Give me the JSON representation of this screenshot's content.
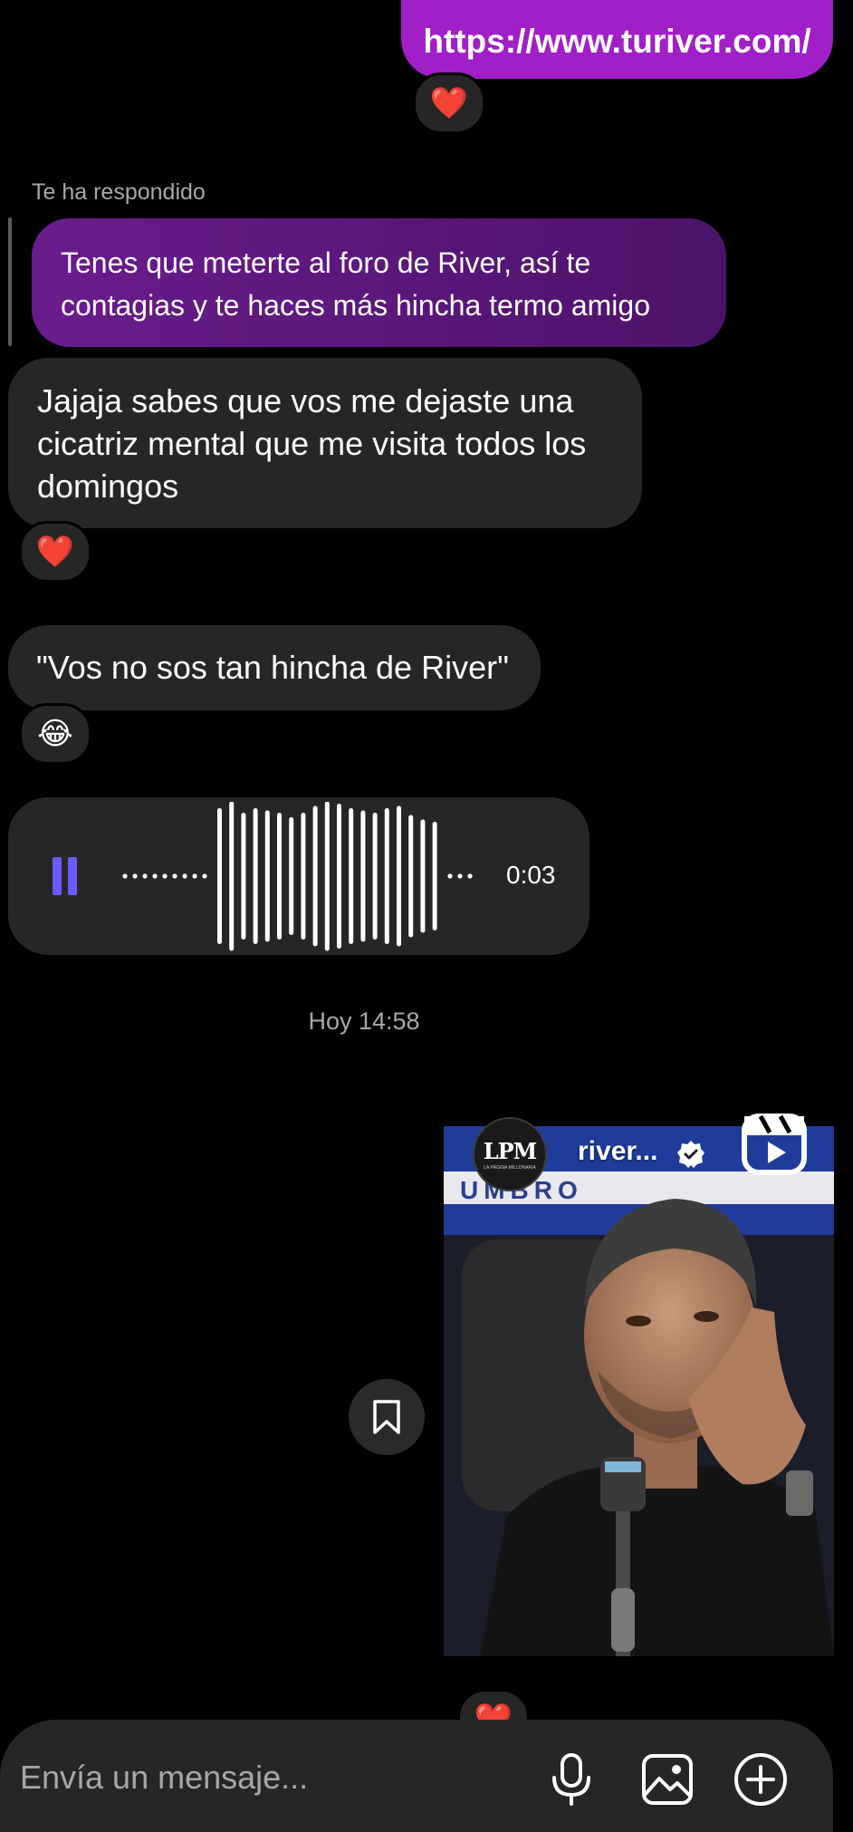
{
  "messages": {
    "sent_link": "https://www.turiver.com/",
    "reply_label": "Te ha respondido",
    "replied_text": "Tenes que meterte al foro de River, así te contagias y te haces más hincha termo amigo",
    "received_1": "Jajaja sabes que vos me dejaste una cicatriz mental que me visita todos los domingos",
    "received_2": "\"Vos no sos tan hincha de River\"",
    "voice_duration": "0:03",
    "timestamp": "Hoy 14:58"
  },
  "reactions": {
    "heart": "❤️",
    "laugh": "😂"
  },
  "reel": {
    "username": "river...",
    "avatar_text": "LPM",
    "avatar_subtext": "LA PÁGINA MILLONARIA",
    "banner_text": "UMBRO"
  },
  "composer": {
    "placeholder": "Envía un mensaje..."
  },
  "colors": {
    "accent_purple": "#a11fc7",
    "bubble_received": "#262626",
    "pause_icon": "#6b5bff"
  }
}
